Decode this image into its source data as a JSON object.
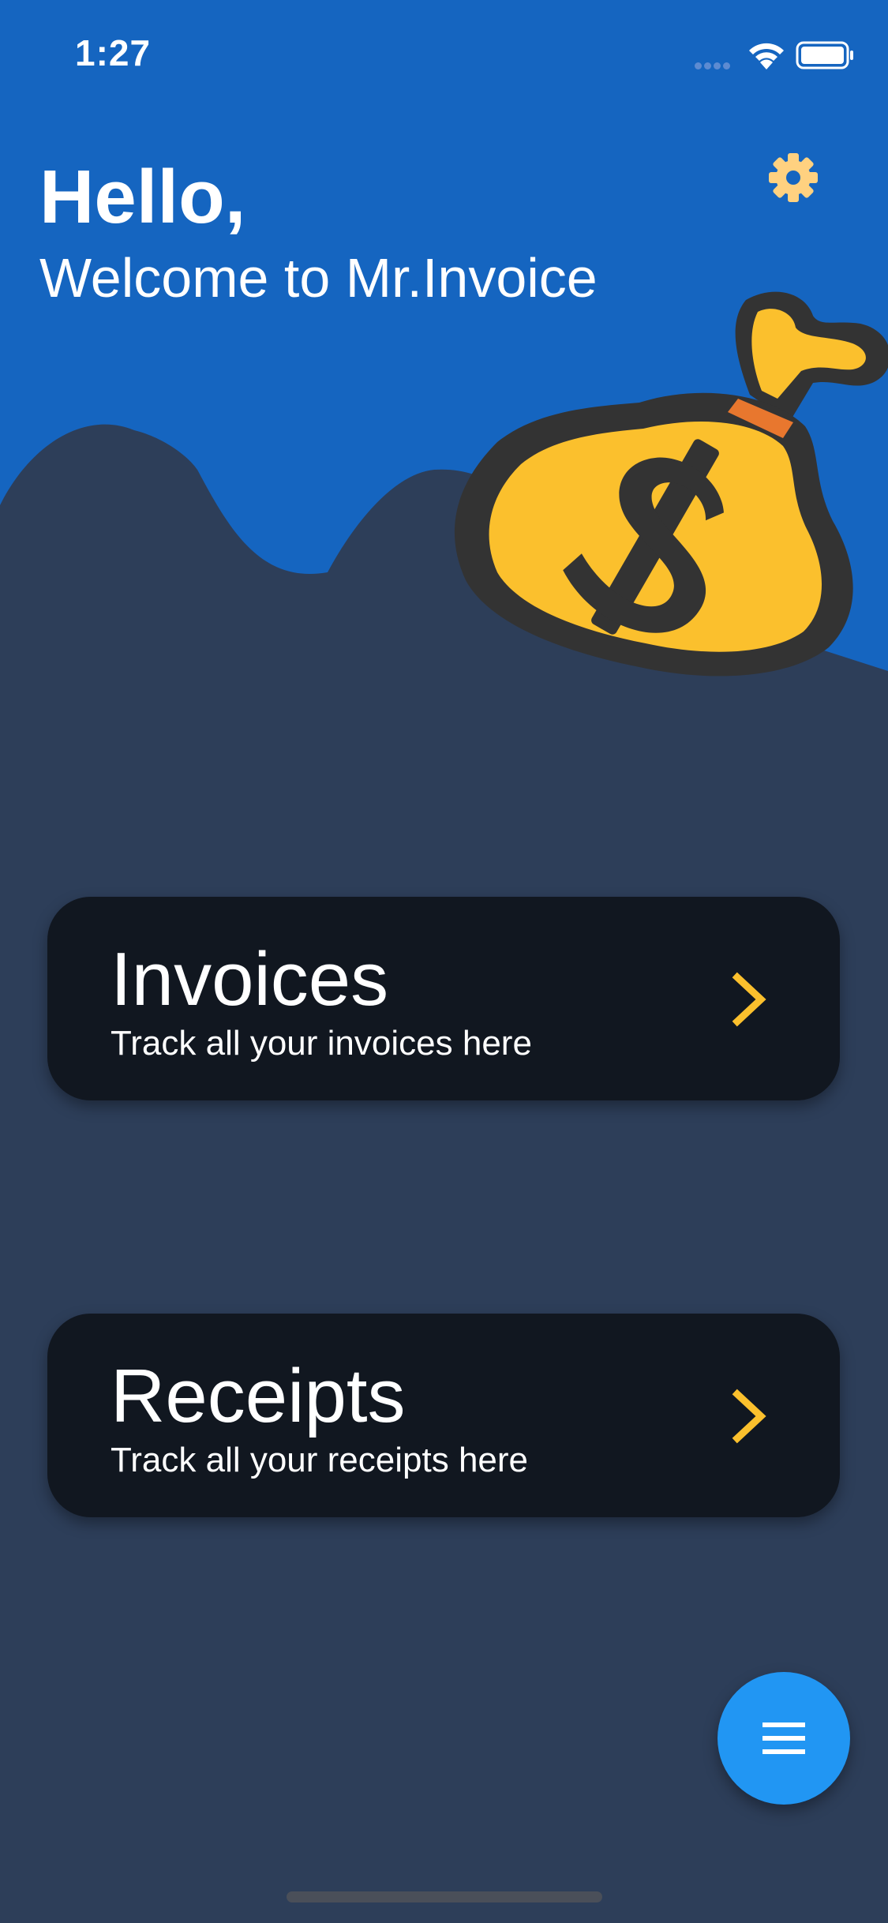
{
  "status": {
    "time": "1:27"
  },
  "header": {
    "greeting": "Hello,",
    "welcome": "Welcome to Mr.Invoice"
  },
  "cards": [
    {
      "title": "Invoices",
      "subtitle": "Track all your invoices here"
    },
    {
      "title": "Receipts",
      "subtitle": "Track all your receipts here"
    }
  ],
  "icons": {
    "settings": "gear-icon",
    "illustration": "money-bag-icon",
    "card_arrow": "chevron-right-icon",
    "fab": "menu-icon"
  },
  "colors": {
    "header_blue": "#1565c0",
    "background": "#2d3e59",
    "card": "#111720",
    "accent_yellow": "#fbc02d",
    "fab": "#2196f3"
  }
}
